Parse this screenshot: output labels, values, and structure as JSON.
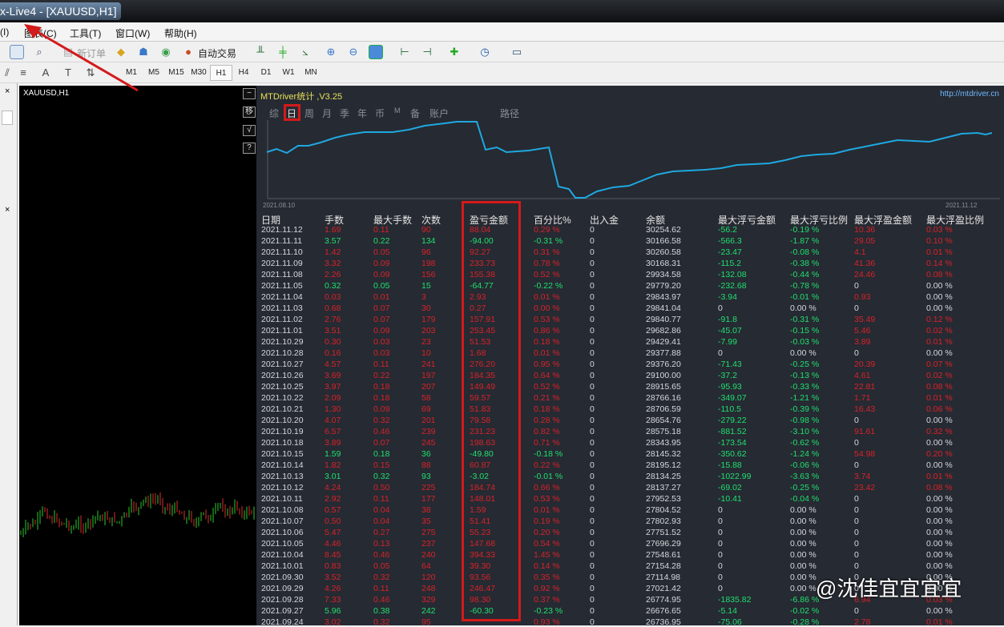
{
  "window": {
    "title": "x-Live4 - [XAUUSD,H1]"
  },
  "menu": [
    "(I)",
    "图表(C)",
    "工具(T)",
    "窗口(W)",
    "帮助(H)"
  ],
  "toolbar": {
    "new_order": "新订单",
    "auto_trading": "自动交易"
  },
  "timeframes": [
    "M1",
    "M5",
    "M15",
    "M30",
    "H1",
    "H4",
    "D1",
    "W1",
    "MN"
  ],
  "active_timeframe": "H1",
  "chart": {
    "symbol": "XAUUSD,H1"
  },
  "side_buttons": [
    "−",
    "移",
    "√",
    "?"
  ],
  "panel": {
    "title": "MTDriver统计 ,V3.25",
    "url": "http://mtdriver.cn",
    "tabs": [
      "综",
      "日",
      "周",
      "月",
      "季",
      "年",
      "币",
      "M",
      "备",
      "账户",
      "路径"
    ],
    "active_tab": "日",
    "equity_start": "2021.08.10",
    "equity_end": "2021.11.12"
  },
  "table": {
    "headers": [
      "日期",
      "手数",
      "最大手数",
      "次数",
      "盈亏金额",
      "百分比%",
      "出入金",
      "余额",
      "最大浮亏金额",
      "最大浮亏比例",
      "最大浮盈金额",
      "最大浮盈比例"
    ],
    "rows": [
      [
        "2021.11.12",
        "1.69",
        "0.11",
        "90",
        "88.04",
        "0.29 %",
        "0",
        "30254.62",
        "-56.2",
        "-0.19 %",
        "10.36",
        "0.03 %"
      ],
      [
        "2021.11.11",
        "3.57",
        "0.22",
        "134",
        "-94.00",
        "-0.31 %",
        "0",
        "30166.58",
        "-566.3",
        "-1.87 %",
        "29.05",
        "0.10 %"
      ],
      [
        "2021.11.10",
        "1.42",
        "0.05",
        "96",
        "92.27",
        "0.31 %",
        "0",
        "30260.58",
        "-23.47",
        "-0.08 %",
        "4.1",
        "0.01 %"
      ],
      [
        "2021.11.09",
        "3.32",
        "0.09",
        "198",
        "233.73",
        "0.78 %",
        "0",
        "30168.31",
        "-115.2",
        "-0.38 %",
        "41.36",
        "0.14 %"
      ],
      [
        "2021.11.08",
        "2.26",
        "0.09",
        "156",
        "155.38",
        "0.52 %",
        "0",
        "29934.58",
        "-132.08",
        "-0.44 %",
        "24.46",
        "0.08 %"
      ],
      [
        "2021.11.05",
        "0.32",
        "0.05",
        "15",
        "-64.77",
        "-0.22 %",
        "0",
        "29779.20",
        "-232.68",
        "-0.78 %",
        "0",
        "0.00 %"
      ],
      [
        "2021.11.04",
        "0.03",
        "0.01",
        "3",
        "2.93",
        "0.01 %",
        "0",
        "29843.97",
        "-3.94",
        "-0.01 %",
        "0.93",
        "0.00 %"
      ],
      [
        "2021.11.03",
        "0.68",
        "0.07",
        "30",
        "0.27",
        "0.00 %",
        "0",
        "29841.04",
        "0",
        "0.00 %",
        "0",
        "0.00 %"
      ],
      [
        "2021.11.02",
        "2.76",
        "0.07",
        "179",
        "157.91",
        "0.53 %",
        "0",
        "29840.77",
        "-91.8",
        "-0.31 %",
        "35.49",
        "0.12 %"
      ],
      [
        "2021.11.01",
        "3.51",
        "0.09",
        "203",
        "253.45",
        "0.86 %",
        "0",
        "29682.86",
        "-45.07",
        "-0.15 %",
        "5.46",
        "0.02 %"
      ],
      [
        "2021.10.29",
        "0.30",
        "0.03",
        "23",
        "51.53",
        "0.18 %",
        "0",
        "29429.41",
        "-7.99",
        "-0.03 %",
        "3.89",
        "0.01 %"
      ],
      [
        "2021.10.28",
        "0.16",
        "0.03",
        "10",
        "1.68",
        "0.01 %",
        "0",
        "29377.88",
        "0",
        "0.00 %",
        "0",
        "0.00 %"
      ],
      [
        "2021.10.27",
        "4.57",
        "0.11",
        "241",
        "276.20",
        "0.95 %",
        "0",
        "29376.20",
        "-71.43",
        "-0.25 %",
        "20.39",
        "0.07 %"
      ],
      [
        "2021.10.26",
        "3.69",
        "0.22",
        "197",
        "184.35",
        "0.64 %",
        "0",
        "29100.00",
        "-37.2",
        "-0.13 %",
        "4.61",
        "0.02 %"
      ],
      [
        "2021.10.25",
        "3.97",
        "0.18",
        "207",
        "149.49",
        "0.52 %",
        "0",
        "28915.65",
        "-95.93",
        "-0.33 %",
        "22.81",
        "0.08 %"
      ],
      [
        "2021.10.22",
        "2.09",
        "0.18",
        "58",
        "59.57",
        "0.21 %",
        "0",
        "28766.16",
        "-349.07",
        "-1.21 %",
        "1.71",
        "0.01 %"
      ],
      [
        "2021.10.21",
        "1.30",
        "0.09",
        "69",
        "51.83",
        "0.18 %",
        "0",
        "28706.59",
        "-110.5",
        "-0.39 %",
        "16.43",
        "0.06 %"
      ],
      [
        "2021.10.20",
        "4.07",
        "0.32",
        "201",
        "79.58",
        "0.28 %",
        "0",
        "28654.76",
        "-279.22",
        "-0.98 %",
        "0",
        "0.00 %"
      ],
      [
        "2021.10.19",
        "6.57",
        "0.46",
        "239",
        "231.23",
        "0.82 %",
        "0",
        "28575.18",
        "-881.52",
        "-3.10 %",
        "91.61",
        "0.32 %"
      ],
      [
        "2021.10.18",
        "3.89",
        "0.07",
        "245",
        "198.63",
        "0.71 %",
        "0",
        "28343.95",
        "-173.54",
        "-0.62 %",
        "0",
        "0.00 %"
      ],
      [
        "2021.10.15",
        "1.59",
        "0.18",
        "36",
        "-49.80",
        "-0.18 %",
        "0",
        "28145.32",
        "-350.62",
        "-1.24 %",
        "54.98",
        "0.20 %"
      ],
      [
        "2021.10.14",
        "1.82",
        "0.15",
        "88",
        "60.87",
        "0.22 %",
        "0",
        "28195.12",
        "-15.88",
        "-0.06 %",
        "0",
        "0.00 %"
      ],
      [
        "2021.10.13",
        "3.01",
        "0.32",
        "93",
        "-3.02",
        "-0.01 %",
        "0",
        "28134.25",
        "-1022.99",
        "-3.63 %",
        "3.74",
        "0.01 %"
      ],
      [
        "2021.10.12",
        "4.24",
        "0.50",
        "225",
        "184.74",
        "0.66 %",
        "0",
        "28137.27",
        "-69.02",
        "-0.25 %",
        "23.42",
        "0.08 %"
      ],
      [
        "2021.10.11",
        "2.92",
        "0.11",
        "177",
        "148.01",
        "0.53 %",
        "0",
        "27952.53",
        "-10.41",
        "-0.04 %",
        "0",
        "0.00 %"
      ],
      [
        "2021.10.08",
        "0.57",
        "0.04",
        "38",
        "1.59",
        "0.01 %",
        "0",
        "27804.52",
        "0",
        "0.00 %",
        "0",
        "0.00 %"
      ],
      [
        "2021.10.07",
        "0.50",
        "0.04",
        "35",
        "51.41",
        "0.19 %",
        "0",
        "27802.93",
        "0",
        "0.00 %",
        "0",
        "0.00 %"
      ],
      [
        "2021.10.06",
        "5.47",
        "0.27",
        "275",
        "55.23",
        "0.20 %",
        "0",
        "27751.52",
        "0",
        "0.00 %",
        "0",
        "0.00 %"
      ],
      [
        "2021.10.05",
        "4.46",
        "0.13",
        "237",
        "147.68",
        "0.54 %",
        "0",
        "27696.29",
        "0",
        "0.00 %",
        "0",
        "0.00 %"
      ],
      [
        "2021.10.04",
        "8.45",
        "0.46",
        "240",
        "394.33",
        "1.45 %",
        "0",
        "27548.61",
        "0",
        "0.00 %",
        "0",
        "0.00 %"
      ],
      [
        "2021.10.01",
        "0.83",
        "0.05",
        "64",
        "39.30",
        "0.14 %",
        "0",
        "27154.28",
        "0",
        "0.00 %",
        "0",
        "0.00 %"
      ],
      [
        "2021.09.30",
        "3.52",
        "0.32",
        "120",
        "93.56",
        "0.35 %",
        "0",
        "27114.98",
        "0",
        "0.00 %",
        "0",
        "0.00 %"
      ],
      [
        "2021.09.29",
        "4.26",
        "0.11",
        "248",
        "246.47",
        "0.92 %",
        "0",
        "27021.42",
        "0",
        "0.00 %",
        "0",
        "0.00 %"
      ],
      [
        "2021.09.28",
        "7.33",
        "0.46",
        "329",
        "98.30",
        "0.37 %",
        "0",
        "26774.95",
        "-1835.82",
        "-6.86 %",
        "6.94",
        "0.03 %"
      ],
      [
        "2021.09.27",
        "5.96",
        "0.38",
        "242",
        "-60.30",
        "-0.23 %",
        "0",
        "26676.65",
        "-5.14",
        "-0.02 %",
        "0",
        "0.00 %"
      ],
      [
        "2021.09.24",
        "3.02",
        "0.32",
        "95",
        "",
        "0.93 %",
        "0",
        "26736.95",
        "-75.06",
        "-0.28 %",
        "2.78",
        "0.01 %"
      ]
    ]
  },
  "watermark": "@沈佳宜宜宜宜",
  "colors": {
    "loss": "#1fe070",
    "profit": "#d8222a",
    "neutral": "#d6d8dc",
    "equity_line": "#1fa8e0",
    "annotation": "#d41a1a"
  }
}
